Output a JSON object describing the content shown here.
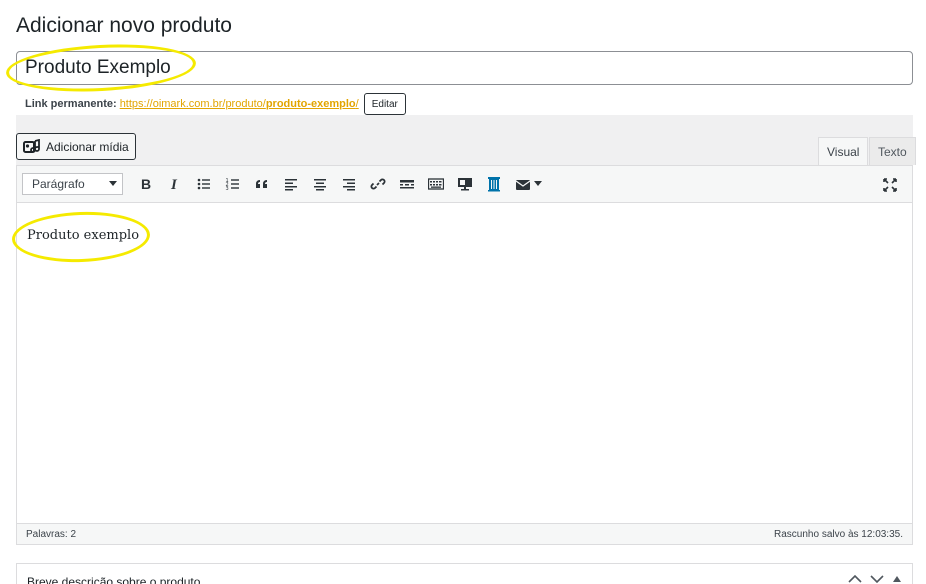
{
  "page": {
    "title": "Adicionar novo produto"
  },
  "product": {
    "title_value": "Produto Exemplo"
  },
  "permalink": {
    "label": "Link permanente:",
    "url_base": "https://oimark.com.br/produto/",
    "slug": "produto-exemplo",
    "slash": "/",
    "edit_label": "Editar"
  },
  "editor": {
    "add_media_label": "Adicionar mídia",
    "tabs": {
      "visual": "Visual",
      "text": "Texto"
    },
    "format_select": {
      "selected": "Parágrafo"
    },
    "content": "Produto exemplo",
    "word_count": "Palavras: 2",
    "draft_status": "Rascunho salvo às 12:03:35."
  },
  "meta_box": {
    "title": "Breve descrição sobre o produto"
  },
  "colors": {
    "link": "#e2a500",
    "highlight": "#f5ea00",
    "accent": "#0073aa"
  },
  "icons": [
    "bold-icon",
    "italic-icon",
    "bullet-list-icon",
    "numbered-list-icon",
    "blockquote-icon",
    "align-left-icon",
    "align-center-icon",
    "align-right-icon",
    "link-icon",
    "read-more-icon",
    "toolbar-toggle-icon",
    "monitor-icon",
    "column-icon",
    "mail-icon",
    "fullscreen-icon"
  ]
}
